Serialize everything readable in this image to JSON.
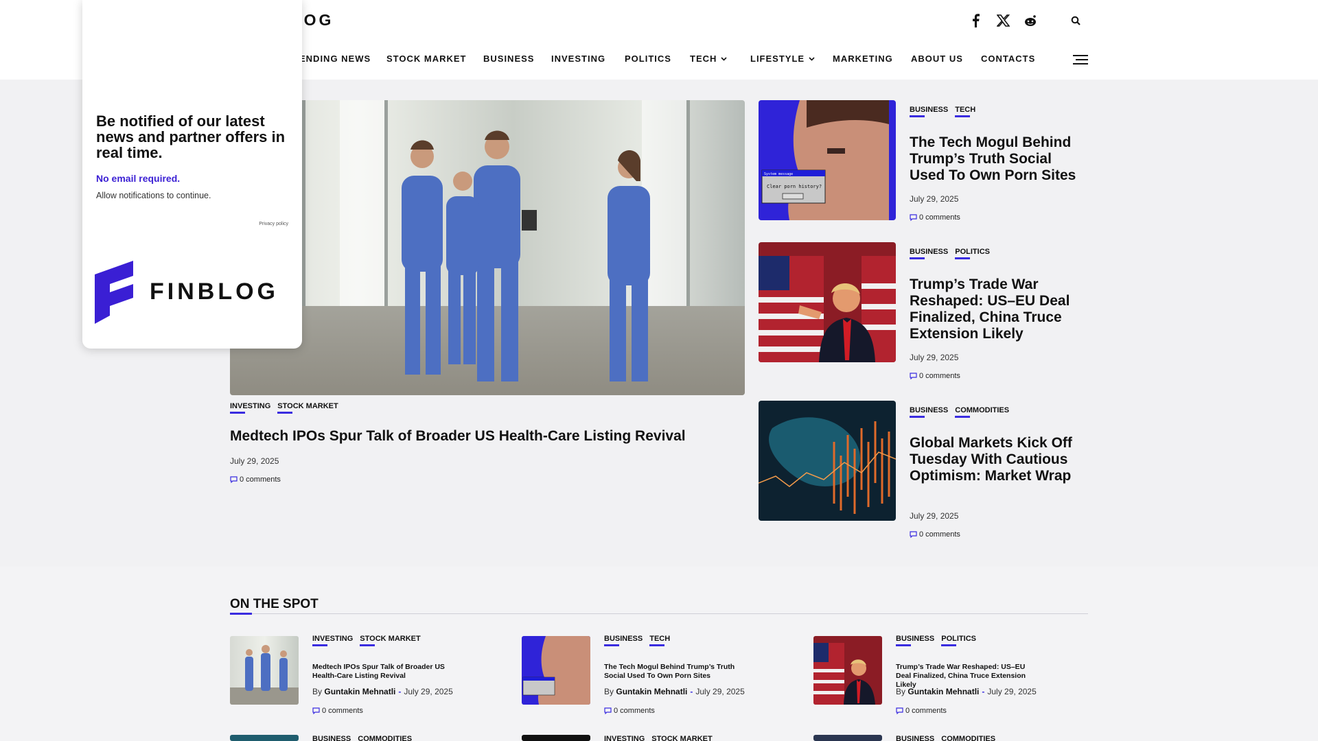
{
  "header": {
    "logo_text": "BLOG",
    "nav": [
      {
        "label": "ENDING NEWS",
        "dropdown": false
      },
      {
        "label": "STOCK MARKET",
        "dropdown": false
      },
      {
        "label": "BUSINESS",
        "dropdown": false
      },
      {
        "label": "INVESTING",
        "dropdown": false
      },
      {
        "label": "POLITICS",
        "dropdown": false
      },
      {
        "label": "TECH",
        "dropdown": true
      },
      {
        "label": "LIFESTYLE",
        "dropdown": true
      },
      {
        "label": "MARKETING",
        "dropdown": false
      },
      {
        "label": "ABOUT US",
        "dropdown": false
      },
      {
        "label": "CONTACTS",
        "dropdown": false
      }
    ],
    "icons": [
      "facebook-icon",
      "x-icon",
      "reddit-icon",
      "search-icon",
      "hamburger-menu-icon"
    ]
  },
  "hero": {
    "tags": [
      "INVESTING",
      "STOCK MARKET"
    ],
    "title": "Medtech IPOs Spur Talk of Broader US Health-Care Listing Revival",
    "date": "July 29, 2025",
    "comments": "0 comments"
  },
  "side_articles": [
    {
      "tags": [
        "BUSINESS",
        "TECH"
      ],
      "title": "The Tech Mogul Behind Trump’s Truth Social Used To Own Porn Sites",
      "date": "July 29, 2025",
      "comments": "0 comments"
    },
    {
      "tags": [
        "BUSINESS",
        "POLITICS"
      ],
      "title": "Trump’s Trade War Reshaped: US–EU Deal Finalized, China Truce Extension Likely",
      "date": "July 29, 2025",
      "comments": "0 comments"
    },
    {
      "tags": [
        "BUSINESS",
        "COMMODITIES"
      ],
      "title": "Global Markets Kick Off Tuesday With Cautious Optimism: Market Wrap",
      "date": "July 29, 2025",
      "comments": "0 comments"
    }
  ],
  "image_texts": {
    "dialog_title": "System message",
    "dialog_body": "Clear porn history?"
  },
  "on_the_spot": {
    "title": "ON THE SPOT",
    "items": [
      {
        "tags": [
          "INVESTING",
          "STOCK MARKET"
        ],
        "title": "Medtech IPOs Spur Talk of Broader US Health-Care Listing Revival",
        "by": "By",
        "author": "Guntakin Mehnatli",
        "date": "July 29, 2025",
        "comments": "0 comments"
      },
      {
        "tags": [
          "BUSINESS",
          "TECH"
        ],
        "title": "The Tech Mogul Behind Trump’s Truth Social Used To Own Porn Sites",
        "by": "By",
        "author": "Guntakin Mehnatli",
        "date": "July 29, 2025",
        "comments": "0 comments"
      },
      {
        "tags": [
          "BUSINESS",
          "POLITICS"
        ],
        "title": "Trump’s Trade War Reshaped: US–EU Deal Finalized, China Truce Extension Likely",
        "by": "By",
        "author": "Guntakin Mehnatli",
        "date": "July 29, 2025",
        "comments": "0 comments"
      }
    ],
    "next_row_tags": [
      [
        "BUSINESS",
        "COMMODITIES"
      ],
      [
        "INVESTING",
        "STOCK MARKET"
      ],
      [
        "BUSINESS",
        "COMMODITIES"
      ]
    ]
  },
  "popup": {
    "headline": "Be notified of our latest news and partner offers in real time.",
    "required": "No email required.",
    "subtext": "Allow notifications to continue.",
    "privacy": "Privacy policy",
    "logo_text": "FINBLOG"
  },
  "colors": {
    "accent": "#3a2ce0",
    "popup_link": "#3a1fd4",
    "page_bg": "#f1f1f3"
  }
}
